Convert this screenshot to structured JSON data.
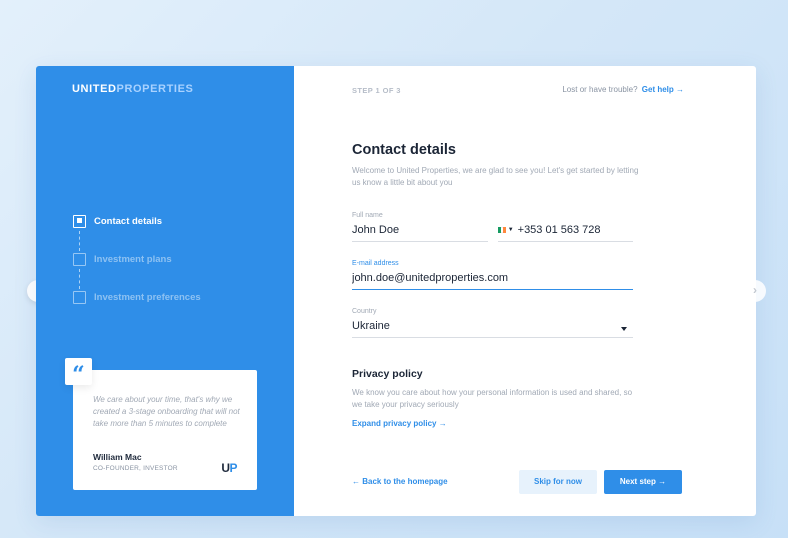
{
  "brand": {
    "part1": "UNITED",
    "part2": "PROPERTIES"
  },
  "steps": [
    {
      "label": "Contact details",
      "active": true
    },
    {
      "label": "Investment plans",
      "active": false
    },
    {
      "label": "Investment preferences",
      "active": false
    }
  ],
  "testimonial": {
    "quote_mark": "“",
    "text": "We care about your time, that's why we created a 3-stage onboarding that will not take more than 5 minutes to complete",
    "author": "William Mac",
    "role": "CO-FOUNDER, INVESTOR",
    "logo_part1": "U",
    "logo_part2": "P"
  },
  "header": {
    "step_count": "STEP 1 OF 3",
    "trouble_text": "Lost or have trouble?",
    "help_link": "Get help →"
  },
  "form": {
    "title": "Contact details",
    "subtitle": "Welcome to United Properties, we are glad to see you! Let's get started by letting us know a little bit about you",
    "full_name": {
      "label": "Full name",
      "value": "John Doe"
    },
    "phone": {
      "value": "+353 01 563 728",
      "flag_colors": [
        "#169b62",
        "#ffffff",
        "#ff883e"
      ]
    },
    "email": {
      "label": "E-mail address",
      "value": "john.doe@unitedproperties.com"
    },
    "country": {
      "label": "Country",
      "value": "Ukraine"
    }
  },
  "privacy": {
    "title": "Privacy policy",
    "text": "We know you care about how your personal information is used and shared, so we take your privacy seriously",
    "link": "Expand privacy policy →"
  },
  "footer": {
    "back_link": "← Back to the homepage",
    "skip_label": "Skip for now",
    "next_label": "Next step →"
  },
  "nav": {
    "prev": "‹",
    "next": "›"
  },
  "colors": {
    "primary": "#2f8ee8",
    "dark": "#1b2536",
    "muted": "#a1a9b5"
  }
}
